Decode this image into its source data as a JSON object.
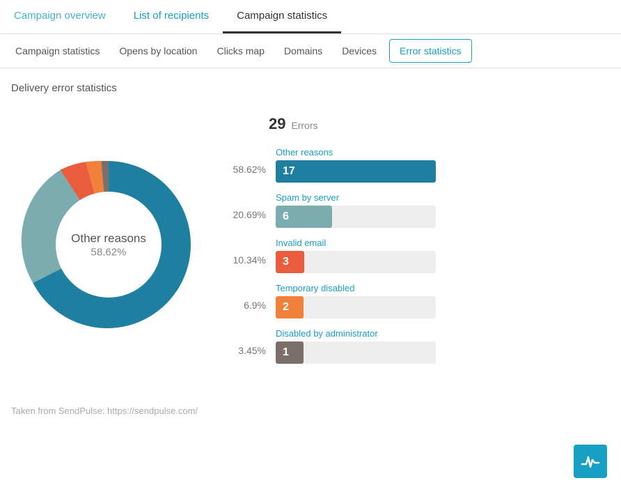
{
  "topTabs": [
    {
      "label": "Campaign overview",
      "active": false
    },
    {
      "label": "List of recipients",
      "active": false
    },
    {
      "label": "Campaign statistics",
      "active": true
    }
  ],
  "subTabs": [
    {
      "label": "Campaign statistics",
      "active": false
    },
    {
      "label": "Opens by location",
      "active": false
    },
    {
      "label": "Clicks map",
      "active": false
    },
    {
      "label": "Domains",
      "active": false
    },
    {
      "label": "Devices",
      "active": false
    },
    {
      "label": "Error statistics",
      "active": true
    }
  ],
  "sectionTitle": "Delivery error statistics",
  "donutCenter": {
    "line1": "Other reasons",
    "line2": "58.62%"
  },
  "totalErrors": {
    "count": "29",
    "label": "Errors"
  },
  "stats": [
    {
      "pct": "58.62%",
      "label": "Other reasons",
      "value": "17",
      "color": "#1e7fa0",
      "barWidth": "100%"
    },
    {
      "pct": "20.69%",
      "label": "Spam by server",
      "value": "6",
      "color": "#7aacb0",
      "barWidth": "35%"
    },
    {
      "pct": "10.34%",
      "label": "Invalid email",
      "value": "3",
      "color": "#e95c3c",
      "barWidth": "18%"
    },
    {
      "pct": "6.9%",
      "label": "Temporary disabled",
      "value": "2",
      "color": "#f0803a",
      "barWidth": "12%"
    },
    {
      "pct": "3.45%",
      "label": "Disabled by administrator",
      "value": "1",
      "color": "#7a6f6a",
      "barWidth": "6%"
    }
  ],
  "footer": "Taken from SendPulse: https://sendpulse.com/",
  "colors": {
    "donutSegments": [
      {
        "color": "#1e7fa0",
        "pct": 58.62
      },
      {
        "color": "#7aacb0",
        "pct": 20.69
      },
      {
        "color": "#e95c3c",
        "pct": 10.34
      },
      {
        "color": "#f0803a",
        "pct": 6.9
      },
      {
        "color": "#7a6f6a",
        "pct": 3.45
      }
    ]
  }
}
